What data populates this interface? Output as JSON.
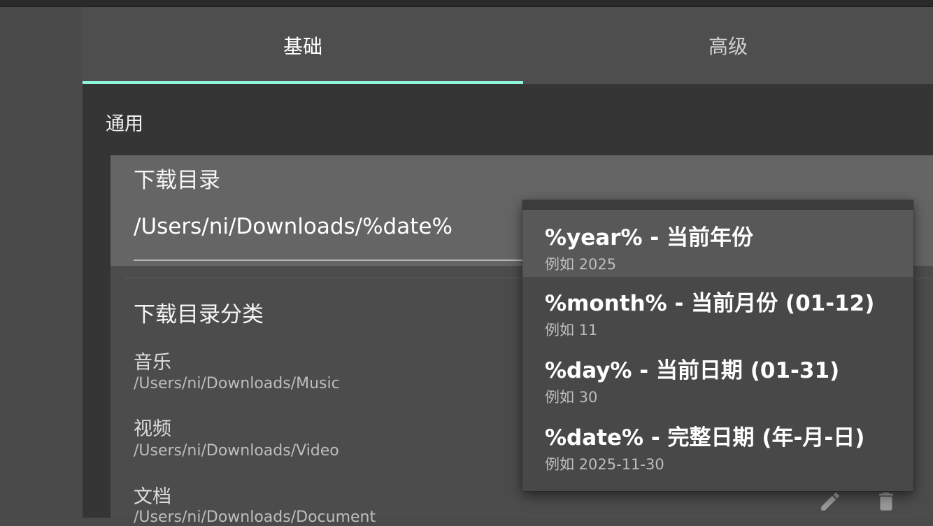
{
  "tabs": [
    {
      "label": "基础",
      "active": true
    },
    {
      "label": "高级",
      "active": false
    }
  ],
  "accent_color": "#8ef5da",
  "section": {
    "title": "通用"
  },
  "download_dir": {
    "label": "下载目录",
    "value": "/Users/ni/Downloads/%date%"
  },
  "categories": {
    "title": "下载目录分类",
    "items": [
      {
        "name": "音乐",
        "path": "/Users/ni/Downloads/Music"
      },
      {
        "name": "视频",
        "path": "/Users/ni/Downloads/Video"
      },
      {
        "name": "文档",
        "path": "/Users/ni/Downloads/Document"
      }
    ]
  },
  "icons": {
    "edit": "pencil-icon",
    "delete": "trash-icon"
  },
  "dropdown": {
    "items": [
      {
        "title": "%year% - 当前年份",
        "example": "例如 2025",
        "highlighted": true
      },
      {
        "title": "%month% - 当前月份 (01-12)",
        "example": "例如 11",
        "highlighted": false
      },
      {
        "title": "%day% - 当前日期 (01-31)",
        "example": "例如 30",
        "highlighted": false
      },
      {
        "title": "%date% - 完整日期 (年-月-日)",
        "example": "例如 2025-11-30",
        "highlighted": false
      }
    ]
  }
}
